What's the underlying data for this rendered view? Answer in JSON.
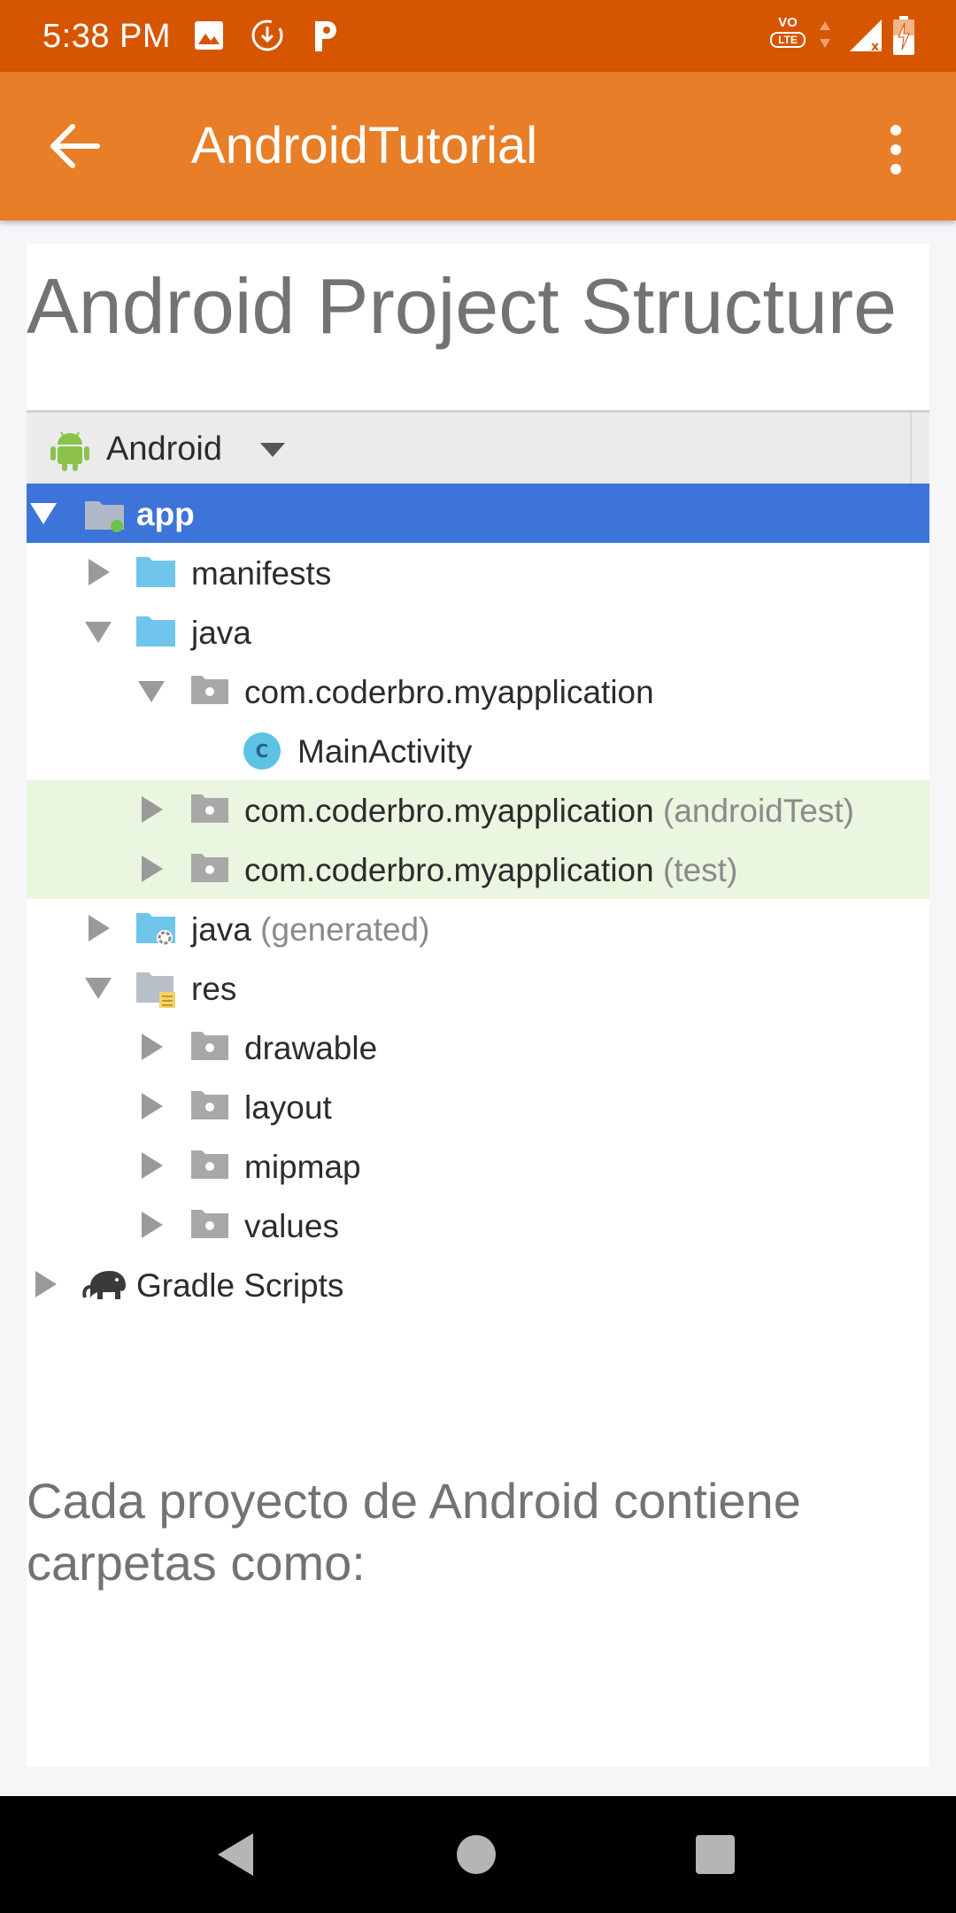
{
  "status_bar": {
    "time": "5:38 PM",
    "icons": [
      "image-icon",
      "download-icon",
      "parking-icon",
      "volte-icon",
      "signal-icon",
      "battery-icon"
    ],
    "volte_label_top": "VO",
    "volte_label_bottom": "LTE"
  },
  "app_bar": {
    "title": "AndroidTutorial",
    "color": "#e87e27"
  },
  "content": {
    "title": "Android Project Structure",
    "body": "Cada proyecto de Android contiene carpetas como:"
  },
  "tree": {
    "header": "Android",
    "rows": [
      {
        "label": "app",
        "suffix": ""
      },
      {
        "label": "manifests",
        "suffix": ""
      },
      {
        "label": "java",
        "suffix": ""
      },
      {
        "label": "com.coderbro.myapplication",
        "suffix": ""
      },
      {
        "label": "MainActivity",
        "suffix": ""
      },
      {
        "label": "com.coderbro.myapplication",
        "suffix": "(androidTest)"
      },
      {
        "label": "com.coderbro.myapplication",
        "suffix": "(test)"
      },
      {
        "label": "java",
        "suffix": "(generated)"
      },
      {
        "label": "res",
        "suffix": ""
      },
      {
        "label": "drawable",
        "suffix": ""
      },
      {
        "label": "layout",
        "suffix": ""
      },
      {
        "label": "mipmap",
        "suffix": ""
      },
      {
        "label": "values",
        "suffix": ""
      },
      {
        "label": "Gradle Scripts",
        "suffix": ""
      }
    ],
    "class_badge": "C"
  },
  "colors": {
    "status_bar": "#d65500",
    "selection": "#3d74d9",
    "test_highlight": "#eaf6e0",
    "folder_blue": "#6fc5ec",
    "folder_gray": "#a8a8a8"
  }
}
